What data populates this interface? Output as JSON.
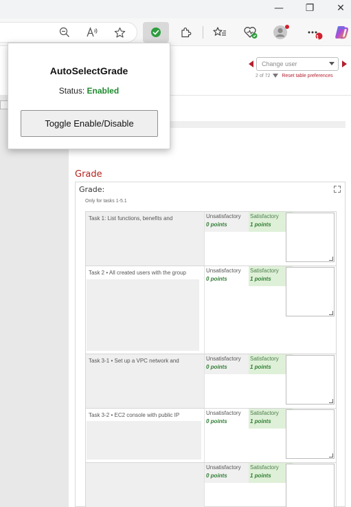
{
  "browser": {
    "window_controls": {
      "minimize": "—",
      "restore": "❐",
      "close": "✕"
    },
    "toolbar_icons": [
      "zoom-out-icon",
      "read-aloud-icon",
      "favorite-star-icon",
      "extension-check-icon",
      "extensions-puzzle-icon",
      "favorites-icon",
      "browser-essentials-icon",
      "profile-icon",
      "more-menu-icon",
      "copilot-icon"
    ],
    "notification_badge": "1",
    "colors": {
      "extension_check": "#2e9d3f",
      "badge": "#d0202e"
    }
  },
  "extension_popup": {
    "title": "AutoSelectGrade",
    "status_label": "Status:",
    "status_value": "Enabled",
    "toggle_button": "Toggle Enable/Disable",
    "colors": {
      "enabled": "#1e8a2e"
    }
  },
  "header": {
    "change_user_placeholder": "Change user",
    "user_position": "2 of 72",
    "reset_link": "Reset table preferences",
    "colors": {
      "accent": "#b31f2e"
    }
  },
  "grade_section": {
    "section_title": "Grade",
    "grade_label": "Grade:",
    "note": "Only for tasks 1-5.1",
    "criteria": [
      {
        "description": "Task 1: List functions, benefits and",
        "levels": [
          {
            "name": "Unsatisfactory",
            "points": "0 points"
          },
          {
            "name": "Satisfactory",
            "points": "1 points"
          }
        ]
      },
      {
        "description": "Task 2 • All created users with the group",
        "levels": [
          {
            "name": "Unsatisfactory",
            "points": "0 points"
          },
          {
            "name": "Satisfactory",
            "points": "1 points"
          }
        ]
      },
      {
        "description": "Task 3-1 • Set up a VPC network and",
        "levels": [
          {
            "name": "Unsatisfactory",
            "points": "0 points"
          },
          {
            "name": "Satisfactory",
            "points": "1 points"
          }
        ]
      },
      {
        "description": "Task 3-2 • EC2 console with public IP",
        "levels": [
          {
            "name": "Unsatisfactory",
            "points": "0 points"
          },
          {
            "name": "Satisfactory",
            "points": "1 points"
          }
        ]
      },
      {
        "description": "",
        "levels": [
          {
            "name": "Unsatisfactory",
            "points": "0 points"
          },
          {
            "name": "Satisfactory",
            "points": "1 points"
          }
        ]
      }
    ]
  }
}
